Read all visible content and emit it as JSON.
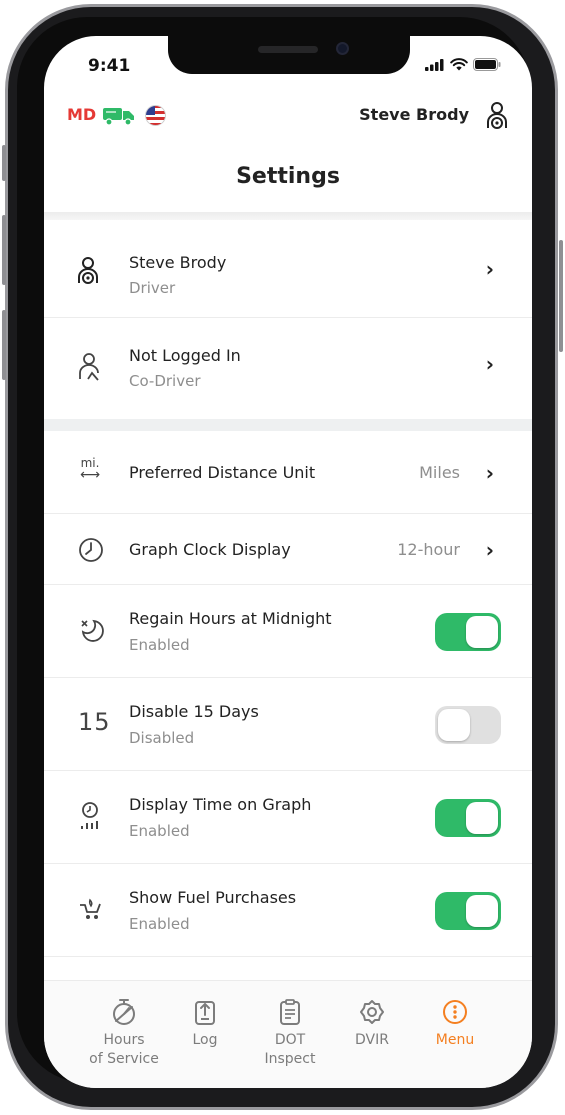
{
  "status_bar": {
    "time": "9:41"
  },
  "top_bar": {
    "region": "MD",
    "user_name": "Steve Brody"
  },
  "page": {
    "title": "Settings"
  },
  "drivers": [
    {
      "name": "Steve Brody",
      "role": "Driver",
      "icon": "driver-icon"
    },
    {
      "name": "Not Logged In",
      "role": "Co-Driver",
      "icon": "co-driver-icon"
    }
  ],
  "settings": [
    {
      "label": "Preferred Distance Unit",
      "value": "Miles",
      "icon": "distance-unit-icon"
    },
    {
      "label": "Graph Clock Display",
      "value": "12-hour",
      "icon": "clock-icon"
    },
    {
      "label": "Regain Hours at Midnight",
      "status": "Enabled",
      "enabled": true,
      "icon": "midnight-icon"
    },
    {
      "label": "Disable 15 Days",
      "status": "Disabled",
      "enabled": false,
      "icon": "fifteen-days-icon"
    },
    {
      "label": "Display Time on Graph",
      "status": "Enabled",
      "enabled": true,
      "icon": "graph-time-icon"
    },
    {
      "label": "Show Fuel Purchases",
      "status": "Enabled",
      "enabled": true,
      "icon": "fuel-icon"
    }
  ],
  "icon_glyphs": {
    "mi": "mi.",
    "fifteen": "15"
  },
  "tabs": [
    {
      "label": "Hours of Service",
      "line1": "Hours",
      "line2": "of Service",
      "icon": "hours-of-service-icon"
    },
    {
      "label": "Log",
      "line1": "Log",
      "line2": "",
      "icon": "log-icon"
    },
    {
      "label": "DOT Inspect",
      "line1": "DOT",
      "line2": "Inspect",
      "icon": "dot-inspect-icon"
    },
    {
      "label": "DVIR",
      "line1": "DVIR",
      "line2": "",
      "icon": "dvir-icon"
    },
    {
      "label": "Menu",
      "line1": "Menu",
      "line2": "",
      "icon": "menu-icon",
      "active": true
    }
  ],
  "colors": {
    "toggle_on": "#2fba68",
    "accent": "#f47f20",
    "region": "#e53935",
    "truck": "#2fba68"
  }
}
